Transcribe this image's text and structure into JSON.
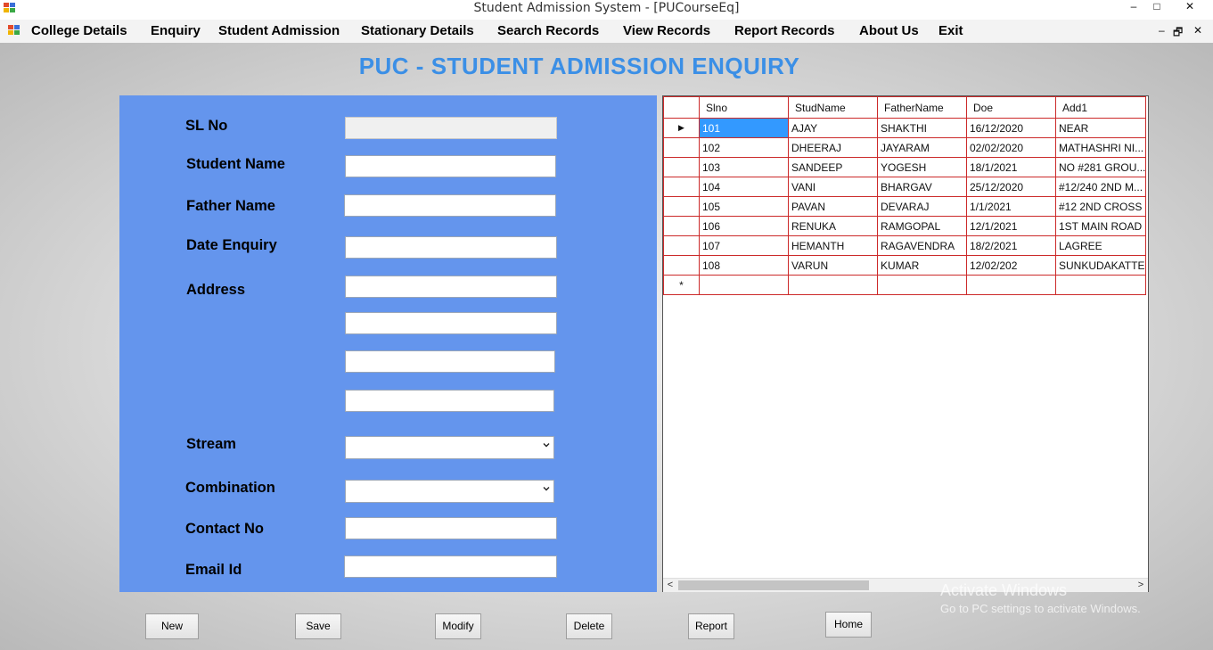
{
  "window": {
    "title": "Student Admission System - [PUCourseEq]",
    "controls": {
      "minimize": "–",
      "maximize": "□",
      "close": "✕"
    }
  },
  "menubar": {
    "items": [
      "College Details",
      "Enquiry",
      "Student Admission",
      "Stationary Details",
      "Search Records",
      "View Records",
      "Report Records",
      "About Us",
      "Exit"
    ],
    "mdi_controls": {
      "minimize": "–",
      "restore": "🗗",
      "close": "✕"
    }
  },
  "page_title": "PUC - STUDENT ADMISSION ENQUIRY",
  "form": {
    "labels": {
      "sl_no": "SL No",
      "student_name": "Student Name",
      "father_name": "Father Name",
      "date_enquiry": "Date Enquiry",
      "address": "Address",
      "stream": "Stream",
      "combination": "Combination",
      "contact_no": "Contact No",
      "email_id": "Email Id"
    },
    "values": {
      "sl_no": "",
      "student_name": "",
      "father_name": "",
      "date_enquiry": "",
      "address1": "",
      "address2": "",
      "address3": "",
      "address4": "",
      "stream": "",
      "combination": "",
      "contact_no": "",
      "email_id": ""
    }
  },
  "grid": {
    "columns": [
      "Slno",
      "StudName",
      "FatherName",
      "Doe",
      "Add1"
    ],
    "rows": [
      [
        "101",
        "AJAY",
        "SHAKTHI",
        "16/12/2020",
        "NEAR"
      ],
      [
        "102",
        "DHEERAJ",
        "JAYARAM",
        "02/02/2020",
        "MATHASHRI NI..."
      ],
      [
        "103",
        "SANDEEP",
        "YOGESH",
        "18/1/2021",
        "NO #281 GROU..."
      ],
      [
        "104",
        "VANI",
        "BHARGAV",
        "25/12/2020",
        "#12/240 2ND M..."
      ],
      [
        "105",
        "PAVAN",
        "DEVARAJ",
        "1/1/2021",
        "#12 2ND CROSS"
      ],
      [
        "106",
        "RENUKA",
        "RAMGOPAL",
        "12/1/2021",
        "1ST MAIN ROAD"
      ],
      [
        "107",
        "HEMANTH",
        "RAGAVENDRA",
        "18/2/2021",
        "LAGREE"
      ],
      [
        "108",
        "VARUN",
        "KUMAR",
        "12/02/202",
        "SUNKUDAKATTE"
      ]
    ],
    "current_row_marker": "▶",
    "new_row_marker": "*",
    "scroll_left": "<",
    "scroll_right": ">"
  },
  "buttons": {
    "new": "New",
    "save": "Save",
    "modify": "Modify",
    "delete": "Delete",
    "report": "Report",
    "home": "Home"
  },
  "watermark": {
    "line1": "Activate Windows",
    "line2": "Go to PC settings to activate Windows."
  },
  "colors": {
    "title_blue": "#3b8fe6",
    "form_panel": "#6495ed",
    "grid_border": "#cc2a2a",
    "selected_cell": "#3399ff"
  }
}
